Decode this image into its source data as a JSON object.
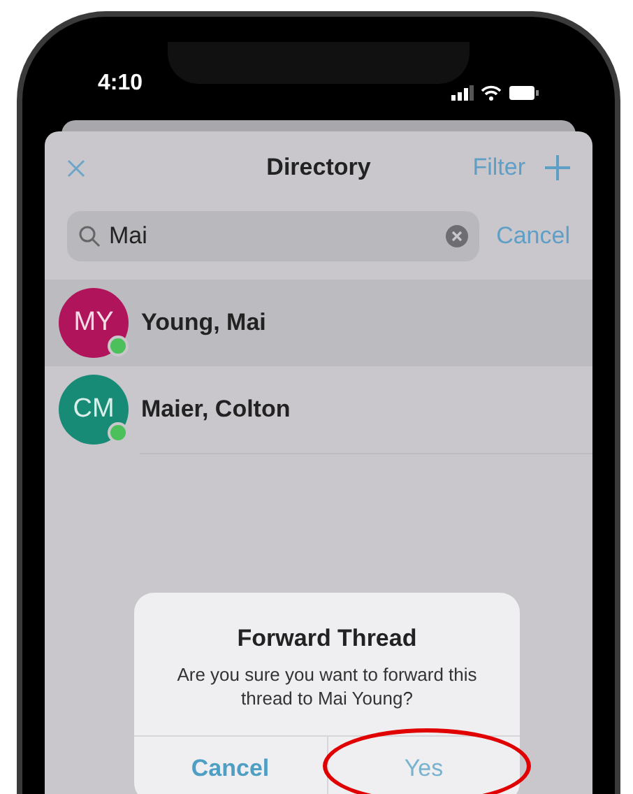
{
  "status_bar": {
    "time": "4:10"
  },
  "header": {
    "title": "Directory",
    "filter": "Filter"
  },
  "search": {
    "value": "Mai",
    "cancel": "Cancel"
  },
  "contacts": [
    {
      "initials": "MY",
      "name": "Young, Mai",
      "color": "#b0145a",
      "selected": true,
      "online": true
    },
    {
      "initials": "CM",
      "name": "Maier, Colton",
      "color": "#178b75",
      "selected": false,
      "online": true
    }
  ],
  "dialog": {
    "title": "Forward Thread",
    "message": "Are you sure you want to forward this thread to Mai Young?",
    "buttons": [
      {
        "label": "Cancel",
        "kind": "cancel"
      },
      {
        "label": "Yes",
        "kind": "confirm"
      }
    ]
  }
}
